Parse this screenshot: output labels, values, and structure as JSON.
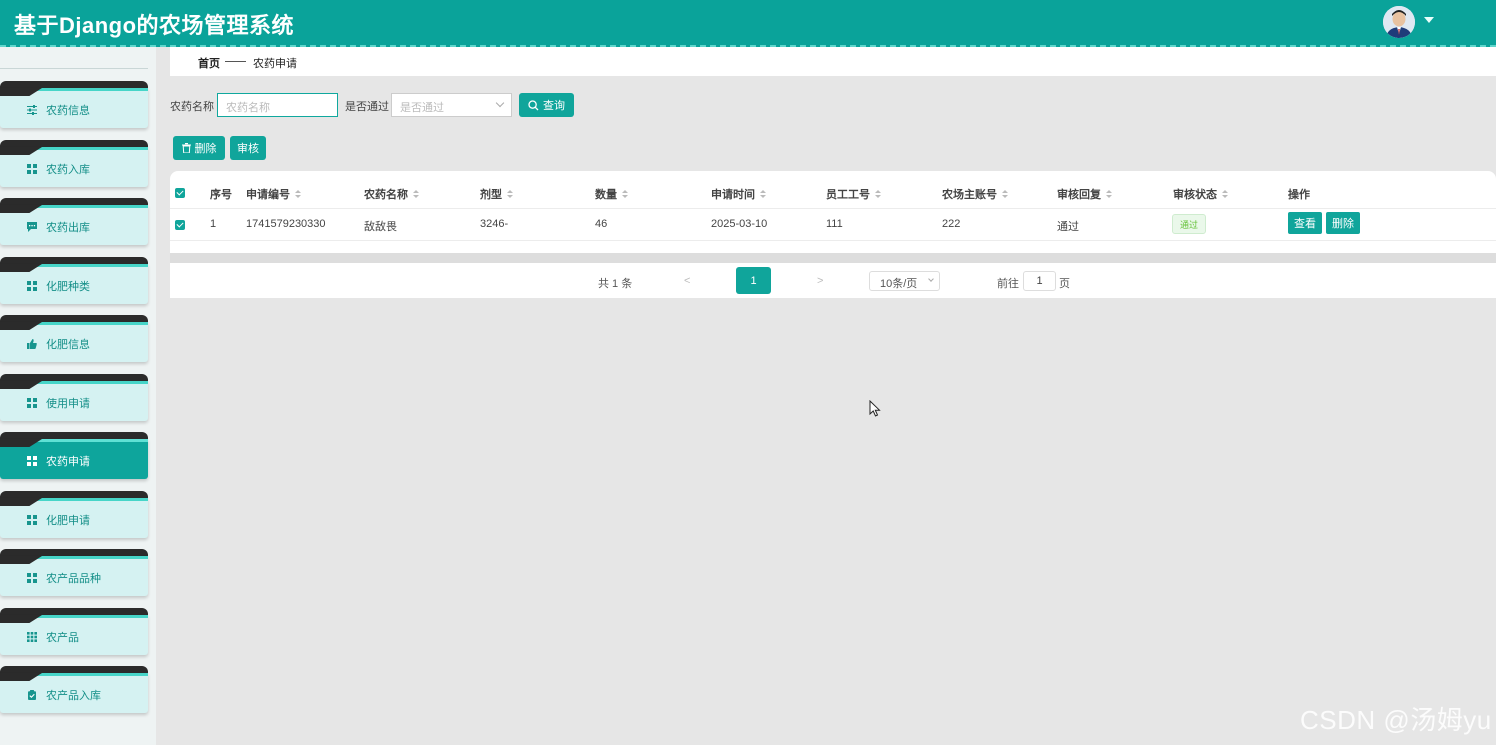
{
  "header": {
    "title": "基于Django的农场管理系统"
  },
  "sidebar": {
    "items": [
      {
        "label": "农药信息",
        "icon": "sliders-icon",
        "active": false
      },
      {
        "label": "农药入库",
        "icon": "grid-icon",
        "active": false
      },
      {
        "label": "农药出库",
        "icon": "message-icon",
        "active": false
      },
      {
        "label": "化肥种类",
        "icon": "grid-icon",
        "active": false
      },
      {
        "label": "化肥信息",
        "icon": "thumb-icon",
        "active": false
      },
      {
        "label": "使用申请",
        "icon": "grid-icon",
        "active": false
      },
      {
        "label": "农药申请",
        "icon": "grid-icon",
        "active": true
      },
      {
        "label": "化肥申请",
        "icon": "grid-icon",
        "active": false
      },
      {
        "label": "农产品品种",
        "icon": "grid-icon",
        "active": false
      },
      {
        "label": "农产品",
        "icon": "grid9-icon",
        "active": false
      },
      {
        "label": "农产品入库",
        "icon": "clipboard-icon",
        "active": false
      }
    ]
  },
  "breadcrumb": {
    "home": "首页",
    "current": "农药申请"
  },
  "search": {
    "name_label": "农药名称",
    "name_placeholder": "农药名称",
    "pass_label": "是否通过",
    "pass_placeholder": "是否通过",
    "query_label": "查询"
  },
  "toolbar": {
    "delete_label": "删除",
    "audit_label": "审核"
  },
  "table": {
    "headers": [
      "序号",
      "申请编号",
      "农药名称",
      "剂型",
      "数量",
      "申请时间",
      "员工工号",
      "农场主账号",
      "审核回复",
      "审核状态",
      "操作"
    ],
    "rows": [
      {
        "index": "1",
        "apply_no": "1741579230330",
        "name": "敌敌畏",
        "form": "3246-",
        "quantity": "46",
        "apply_time": "2025-03-10",
        "staff_no": "111",
        "owner_account": "222",
        "reply": "通过",
        "status": "通过",
        "view_label": "查看",
        "delete_label": "删除"
      }
    ]
  },
  "pagination": {
    "total": "共 1 条",
    "prev": "<",
    "current_page": "1",
    "next": ">",
    "page_size": "10条/页",
    "goto_label": "前往",
    "goto_value": "1",
    "page_unit": "页"
  },
  "watermark": "CSDN @汤姆yu",
  "colors": {
    "primary": "#10a59b",
    "header": "#0aa39a",
    "success": "#67c23a"
  }
}
